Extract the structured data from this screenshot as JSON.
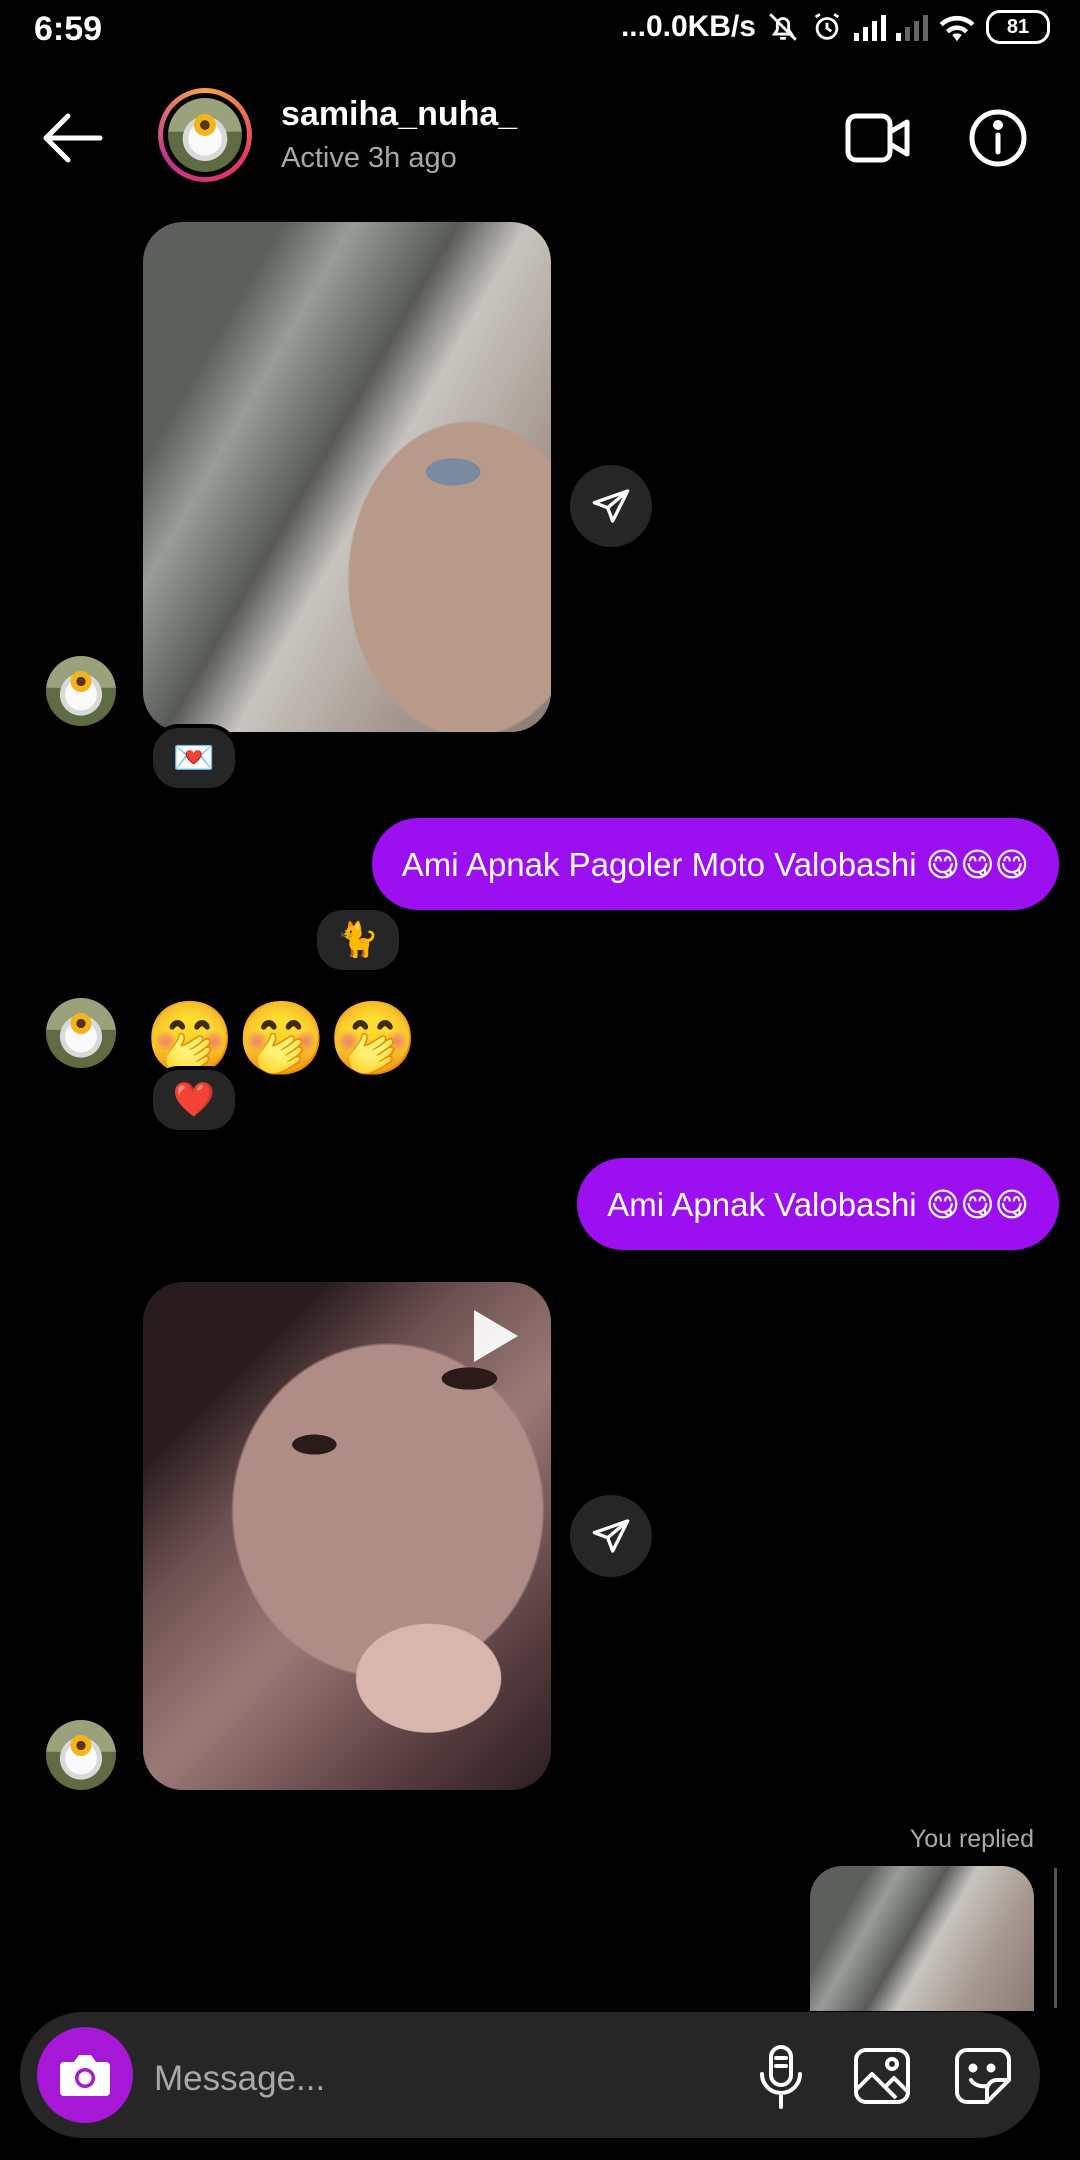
{
  "status_bar": {
    "time": "6:59",
    "network_speed": "...0.0KB/s",
    "battery": "81"
  },
  "header": {
    "username": "samiha_nuha_",
    "activity": "Active 3h ago",
    "icons": [
      "back-arrow-icon",
      "video-call-icon",
      "info-icon"
    ]
  },
  "messages": {
    "outgoing_1": "Ami Apnak Pagoler Moto Valobashi 😋😋😋",
    "outgoing_2": "Ami Apnak Valobashi 😋😋😋",
    "incoming_emoji": "🤭🤭🤭",
    "reaction_photo": "💌",
    "reaction_outgoing_1": "🐈",
    "reaction_emoji_msg": "❤️",
    "you_replied": "You replied"
  },
  "composer": {
    "placeholder": "Message...",
    "icons": [
      "camera-icon",
      "microphone-icon",
      "gallery-icon",
      "sticker-icon"
    ]
  },
  "colors": {
    "background": "#000000",
    "outgoing_bubble": "#9c0ff1",
    "camera_button": "#a717d6",
    "surface": "#262626",
    "secondary_text": "#a8a8a8"
  }
}
